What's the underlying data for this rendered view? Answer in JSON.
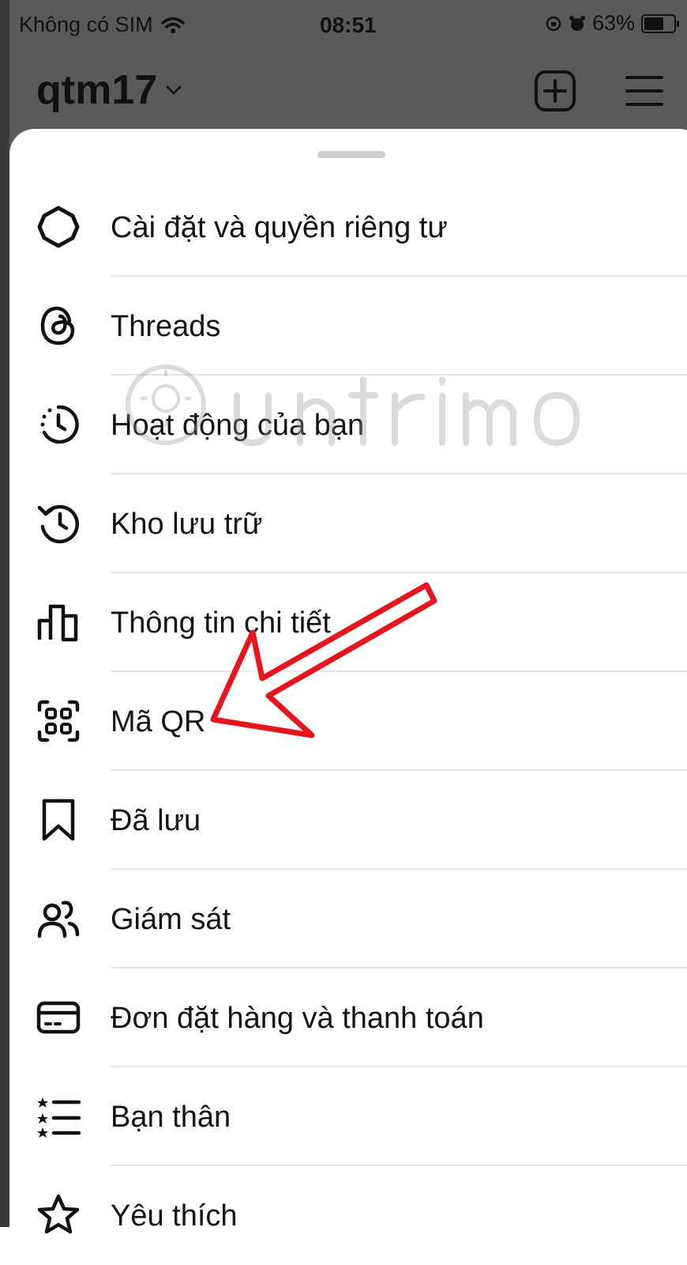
{
  "status_bar": {
    "carrier": "Không có SIM",
    "time": "08:51",
    "battery": "63%"
  },
  "header": {
    "username": "qtm17"
  },
  "menu": [
    {
      "label": "Cài đặt và quyền riêng tư",
      "icon": "gear-icon"
    },
    {
      "label": "Threads",
      "icon": "threads-icon"
    },
    {
      "label": "Hoạt động của bạn",
      "icon": "activity-icon"
    },
    {
      "label": "Kho lưu trữ",
      "icon": "archive-icon"
    },
    {
      "label": "Thông tin chi tiết",
      "icon": "insights-icon"
    },
    {
      "label": "Mã QR",
      "icon": "qr-code-icon"
    },
    {
      "label": "Đã lưu",
      "icon": "bookmark-icon"
    },
    {
      "label": "Giám sát",
      "icon": "supervision-icon"
    },
    {
      "label": "Đơn đặt hàng và thanh toán",
      "icon": "card-icon"
    },
    {
      "label": "Bạn thân",
      "icon": "close-friends-icon"
    },
    {
      "label": "Yêu thích",
      "icon": "star-icon"
    }
  ],
  "colors": {
    "annotation_arrow": "#e8141b",
    "overlay": "#5a5a5a"
  }
}
